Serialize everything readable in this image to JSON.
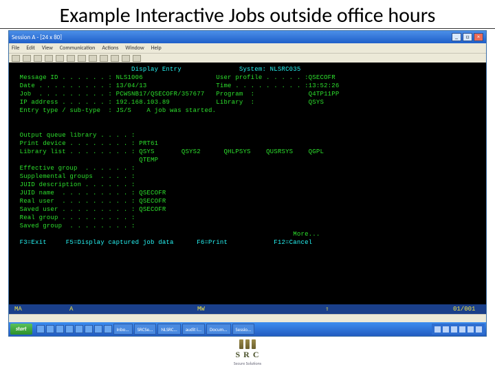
{
  "slide": {
    "title": "Example Interactive Jobs outside office hours"
  },
  "window": {
    "title": "Session A - [24 x 80]",
    "min": "_",
    "max": "□",
    "close": "×",
    "menu": [
      "File",
      "Edit",
      "View",
      "Communication",
      "Actions",
      "Window",
      "Help"
    ]
  },
  "term": {
    "screenTitle": "Display Entry",
    "systemLabel": "System:",
    "systemValue": "NLSRC035",
    "rows": [
      {
        "l": "Message ID . . . . . . :",
        "v": "NLS1006",
        "l2": "User profile . . . . . :",
        "v2": "QSECOFR"
      },
      {
        "l": "Date . . . . . . . . . :",
        "v": "13/04/13",
        "l2": "Time . . . . . . . . . :",
        "v2": "13:52:26"
      },
      {
        "l": "Job  . . . . . . . . . :",
        "v": "PCWSNB17/QSECOFR/357677",
        "l2": "Program  :",
        "v2": "Q4TP11PP"
      },
      {
        "l": "IP address . . . . . . :",
        "v": "192.168.103.89",
        "l2": "Library  :",
        "v2": "QSYS"
      },
      {
        "l": "Entry type / sub-type  :",
        "v": "JS/S    A job was started.",
        "l2": "",
        "v2": ""
      }
    ],
    "block2": [
      {
        "l": "Output queue library . . . . :",
        "v": ""
      },
      {
        "l": "Print device . . . . . . . . :",
        "v": "PRT61"
      },
      {
        "l": "Library list . . . . . . . . :",
        "v": "QSYS       QSYS2      QHLPSYS    QUSRSYS    QGPL"
      },
      {
        "l": "",
        "v": "QTEMP"
      },
      {
        "l": "Effective group  . . . . . . :",
        "v": ""
      },
      {
        "l": "Supplemental groups  . . . . :",
        "v": ""
      },
      {
        "l": "JUID description . . . . . . :",
        "v": ""
      },
      {
        "l": "JUID name  . . . . . . . . . :",
        "v": "QSECOFR"
      },
      {
        "l": "Real user  . . . . . . . . . :",
        "v": "QSECOFR"
      },
      {
        "l": "Saved user . . . . . . . . . :",
        "v": "QSECOFR"
      },
      {
        "l": "Real group . . . . . . . . . :",
        "v": ""
      },
      {
        "l": "Saved group  . . . . . . . . :",
        "v": ""
      }
    ],
    "more": "More...",
    "fkeys": {
      "f3": "F3=Exit",
      "f5": "F5=Display captured job data",
      "f6": "F6=Print",
      "f12": "F12=Cancel"
    }
  },
  "status": {
    "s1": "MA",
    "s2": "A",
    "s3": "MW",
    "s4": "⇧",
    "s5": "01/001"
  },
  "taskbar": {
    "start": "start",
    "items": [
      "Inbo...",
      "SRCSe...",
      "NLSRC...",
      "audit i...",
      "Docum...",
      "Sessio..."
    ]
  },
  "logo": {
    "main": "S R C",
    "sub": "Secure Solutions"
  }
}
